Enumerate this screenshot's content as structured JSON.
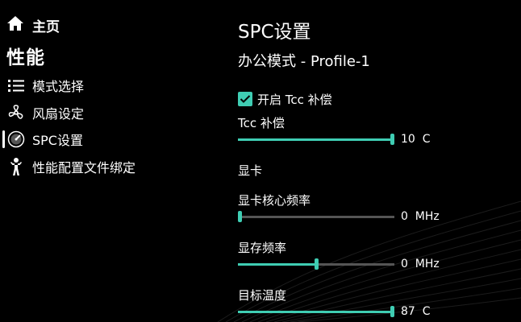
{
  "colors": {
    "accent": "#3fcdb3",
    "track": "#555555",
    "background": "#000000"
  },
  "sidebar": {
    "home_label": "主页",
    "section_title": "性能",
    "items": [
      {
        "label": "模式选择",
        "icon": "list-icon",
        "active": false
      },
      {
        "label": "风扇设定",
        "icon": "fan-icon",
        "active": false
      },
      {
        "label": "SPC设置",
        "icon": "gauge-icon",
        "active": true
      },
      {
        "label": "性能配置文件绑定",
        "icon": "person-icon",
        "active": false
      }
    ]
  },
  "main": {
    "page_title": "SPC设置",
    "profile_title": "办公模式 - Profile-1",
    "tcc_checkbox": {
      "label": "开启 Tcc 补偿",
      "checked": true
    },
    "tcc_slider": {
      "label": "Tcc 补偿",
      "value_text": "10  C",
      "fraction": 1.0
    },
    "gpu_group_label": "显卡",
    "gpu_core_slider": {
      "label": "显卡核心频率",
      "value_text": "0  MHz",
      "fraction": 0.0
    },
    "vram_slider": {
      "label": "显存频率",
      "value_text": "0  MHz",
      "fraction": 0.5
    },
    "target_temp_slider": {
      "label": "目标温度",
      "value_text": "87  C",
      "fraction": 1.0
    }
  }
}
